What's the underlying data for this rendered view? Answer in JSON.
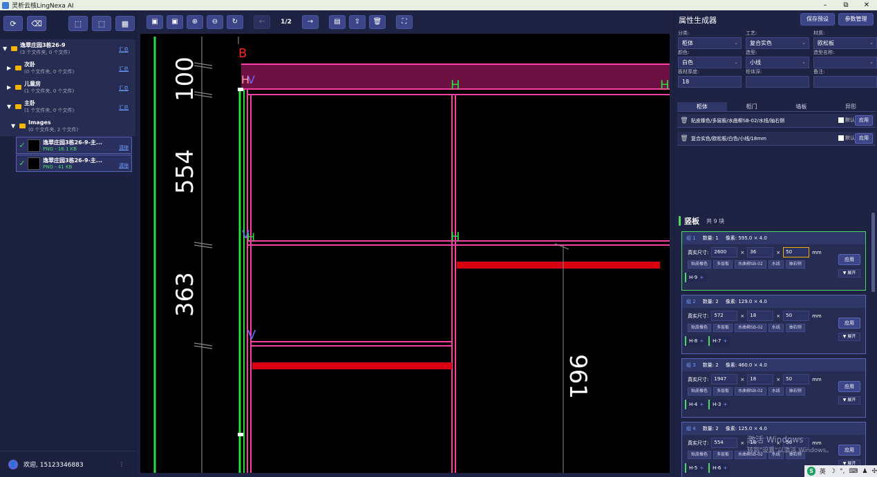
{
  "titlebar": {
    "title": "灵析云核LingNexa AI",
    "min": "–",
    "max": "⧉",
    "close": "✕"
  },
  "left": {
    "tree": [
      {
        "name": "逸翠庄园3栋26-9",
        "sub": "(3 个文件夹, 0 个文件)",
        "sum": "汇总",
        "arrow": "▼",
        "indent": 4
      },
      {
        "name": "次卧",
        "sub": "(0 个文件夹, 0 个文件)",
        "sum": "汇总",
        "arrow": "▶",
        "indent": 10
      },
      {
        "name": "儿童房",
        "sub": "(1 个文件夹, 0 个文件)",
        "sum": "汇总",
        "arrow": "▶",
        "indent": 10
      },
      {
        "name": "主卧",
        "sub": "(1 个文件夹, 0 个文件)",
        "sum": "汇总",
        "arrow": "▼",
        "indent": 10
      },
      {
        "name": "Images",
        "sub": "(0 个文件夹, 2 个文件)",
        "sum": "",
        "arrow": "▼",
        "indent": 16
      }
    ],
    "files": [
      {
        "name": "逸翠庄园3栋26-9-主...",
        "size": "PNG - 16.1 KB",
        "del": "清除"
      },
      {
        "name": "逸翠庄园3栋26-9-主...",
        "size": "PNG - 41 KB",
        "del": "清除"
      }
    ],
    "user": {
      "welcome": "欢迎, 15123346883",
      "more": "⋮"
    }
  },
  "center": {
    "page": "1/2",
    "dims": {
      "d1": "100",
      "d2": "554",
      "d3": "363",
      "d4": "961"
    },
    "labels": {
      "b": "B",
      "h": "H",
      "v": "V"
    }
  },
  "right": {
    "title": "属性生成器",
    "save_preset": "保存预设",
    "param_mgmt": "参数管理",
    "fields": [
      {
        "label": "分类:",
        "value": "柜体",
        "dd": true
      },
      {
        "label": "工艺:",
        "value": "复合实色",
        "dd": true
      },
      {
        "label": "材质:",
        "value": "欧松板",
        "dd": true
      },
      {
        "label": "颜色:",
        "value": "白色",
        "dd": true
      },
      {
        "label": "造型:",
        "value": "小线",
        "dd": true
      },
      {
        "label": "造型名称:",
        "value": "",
        "dd": true
      },
      {
        "label": "板材厚度:",
        "value": "18",
        "dd": false
      },
      {
        "label": "柜体深:",
        "value": "",
        "dd": false
      },
      {
        "label": "备注:",
        "value": "",
        "dd": false
      }
    ],
    "tabs": [
      "柜体",
      "柜门",
      "墙板",
      "异形"
    ],
    "presets": [
      {
        "text": "贴皮橡色/多层板/水曲柳SB-02/水线/抽右侧",
        "dflt": "默认",
        "apply": "应用"
      },
      {
        "text": "复合实色/欧松板/白色/小线/18mm",
        "dflt": "默认",
        "apply": "应用"
      }
    ],
    "vb": {
      "title": "竖板",
      "count": "共 9 块"
    },
    "groups": [
      {
        "g": "组 1",
        "qty": "数量: 1",
        "px": "像素: 595.0 × 4.0",
        "size_label": "真实尺寸:",
        "a": "2600",
        "b": "36",
        "c": "50",
        "unit": "mm",
        "apply": "应用",
        "tags": [
          "贴皮橡色",
          "多层板",
          "水曲柳SB-02",
          "水线",
          "抽右侧"
        ],
        "expand": "▼ 展开",
        "chips": [
          "H-9"
        ]
      },
      {
        "g": "组 2",
        "qty": "数量: 2",
        "px": "像素: 129.0 × 4.0",
        "size_label": "真实尺寸:",
        "a": "572",
        "b": "18",
        "c": "50",
        "unit": "mm",
        "apply": "应用",
        "tags": [
          "贴皮橡色",
          "多层板",
          "水曲柳SB-02",
          "水线",
          "抽右侧"
        ],
        "expand": "▼ 展开",
        "chips": [
          "H-8",
          "H-7"
        ]
      },
      {
        "g": "组 3",
        "qty": "数量: 2",
        "px": "像素: 460.0 × 4.0",
        "size_label": "真实尺寸:",
        "a": "1947",
        "b": "18",
        "c": "50",
        "unit": "mm",
        "apply": "应用",
        "tags": [
          "贴皮橡色",
          "多层板",
          "水曲柳SB-02",
          "水线",
          "抽右侧"
        ],
        "expand": "▼ 展开",
        "chips": [
          "H-4",
          "H-3"
        ]
      },
      {
        "g": "组 4",
        "qty": "数量: 2",
        "px": "像素: 125.0 × 4.0",
        "size_label": "真实尺寸:",
        "a": "554",
        "b": "18",
        "c": "50",
        "unit": "mm",
        "apply": "应用",
        "tags": [
          "贴皮橡色",
          "多层板",
          "水曲柳SB-02",
          "水线",
          "抽右侧"
        ],
        "expand": "▼ 展开",
        "chips": [
          "H-5",
          "H-6"
        ]
      }
    ]
  },
  "os": {
    "wm1": "激活 Windows",
    "wm2": "转到\"设置\"以激活 Windows。",
    "ime_s": "S",
    "ime_lang": "英"
  }
}
